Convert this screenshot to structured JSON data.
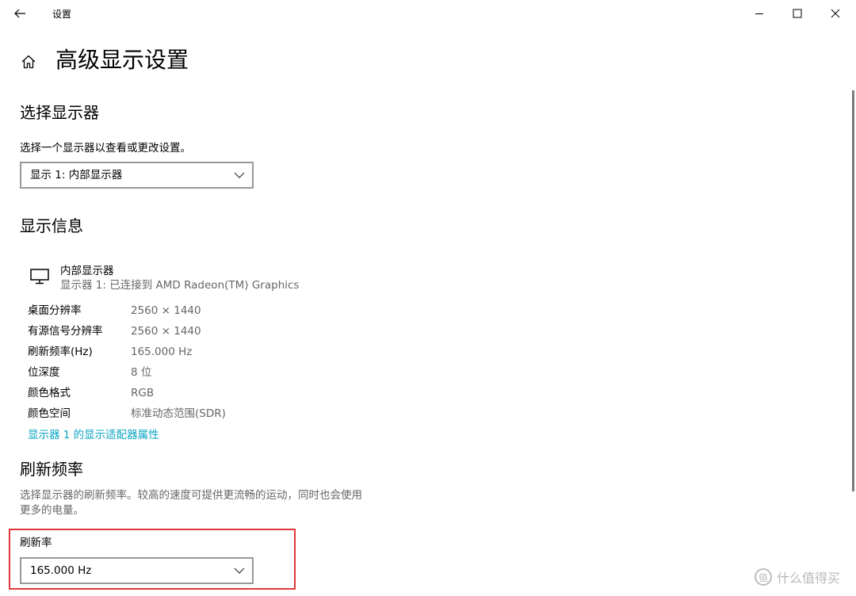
{
  "window": {
    "title": "设置"
  },
  "page": {
    "title": "高级显示设置"
  },
  "select_display": {
    "heading": "选择显示器",
    "description": "选择一个显示器以查看或更改设置。",
    "selected": "显示 1: 内部显示器"
  },
  "display_info": {
    "heading": "显示信息",
    "monitor_name": "内部显示器",
    "monitor_subtitle": "显示器 1: 已连接到 AMD Radeon(TM) Graphics",
    "rows": [
      {
        "label": "桌面分辨率",
        "value": "2560 × 1440"
      },
      {
        "label": "有源信号分辨率",
        "value": "2560 × 1440"
      },
      {
        "label": "刷新频率(Hz)",
        "value": "165.000 Hz"
      },
      {
        "label": "位深度",
        "value": "8 位"
      },
      {
        "label": "颜色格式",
        "value": "RGB"
      },
      {
        "label": "颜色空间",
        "value": "标准动态范围(SDR)"
      }
    ],
    "adapter_link": "显示器 1 的显示适配器属性"
  },
  "refresh": {
    "heading": "刷新频率",
    "description_line1": "选择显示器的刷新频率。较高的速度可提供更流畅的运动，同时也会使用",
    "description_line2": "更多的电量。",
    "label": "刷新率",
    "selected": "165.000 Hz"
  },
  "watermark": {
    "text": "什么值得买",
    "logo_char": "值"
  },
  "colors": {
    "link": "#0aa5c4",
    "highlight_box": "#e03a3a",
    "secondary_text": "#666666"
  },
  "icons": {
    "back": "back-arrow-icon",
    "minimize": "minimize-icon",
    "maximize": "maximize-icon",
    "close": "close-icon",
    "home": "home-icon",
    "monitor": "monitor-icon",
    "chevron": "chevron-down-icon"
  }
}
